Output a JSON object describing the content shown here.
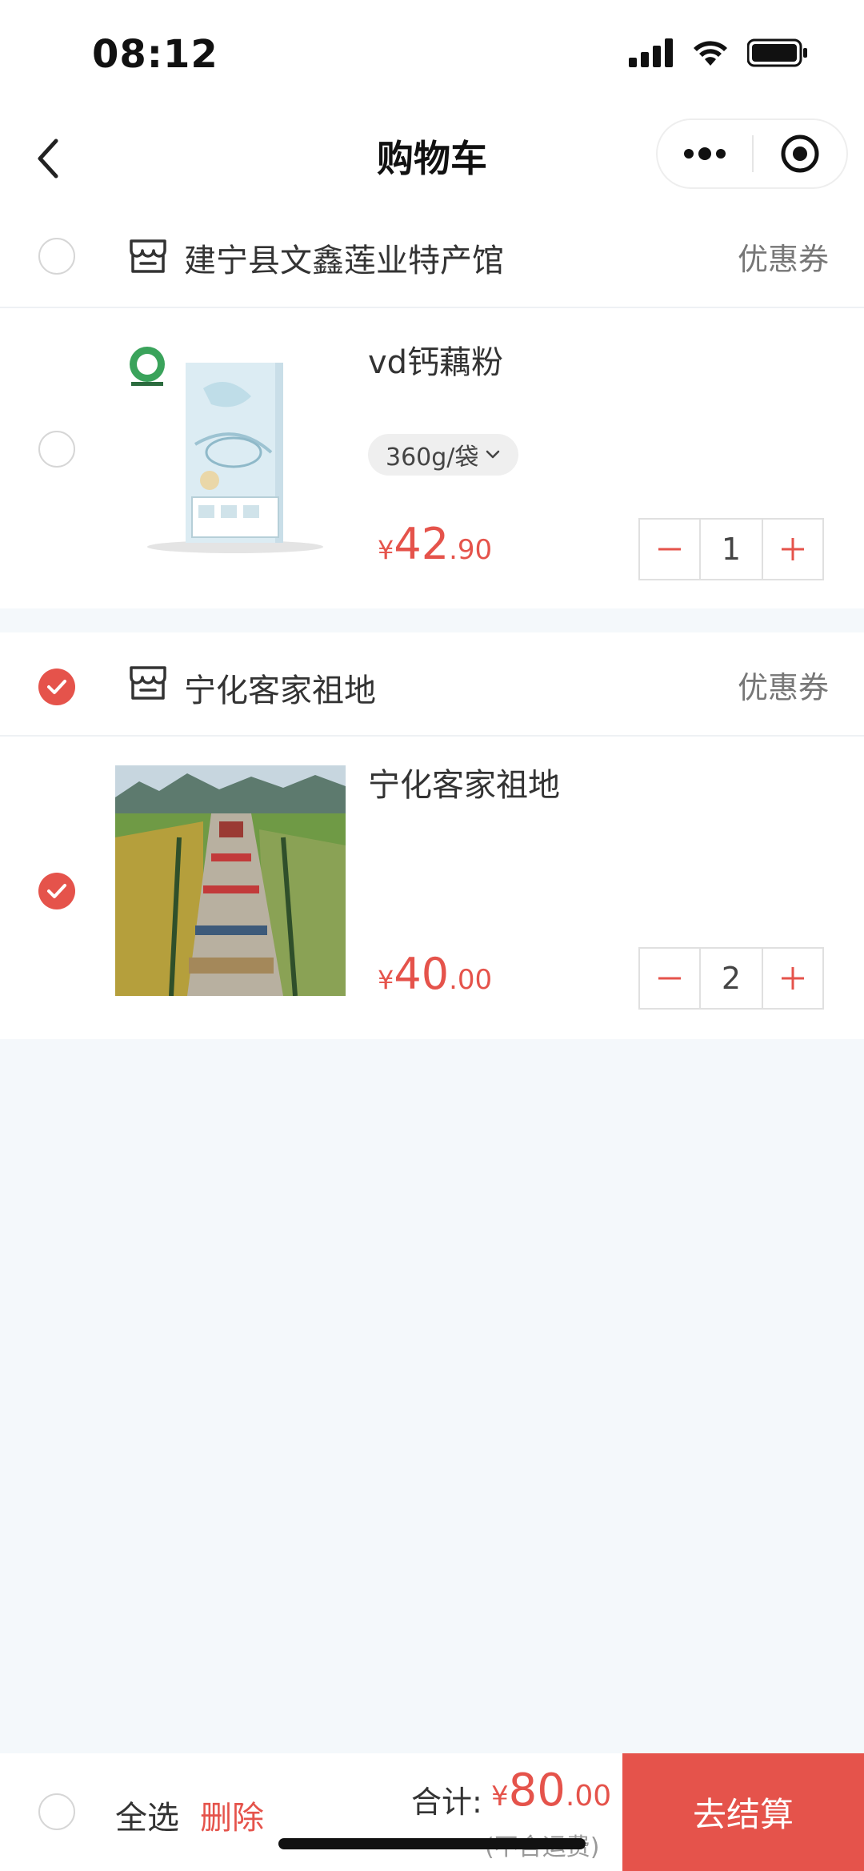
{
  "status_bar": {
    "time": "08:12"
  },
  "nav": {
    "title": "购物车"
  },
  "shops": [
    {
      "name": "建宁县文鑫莲业特产馆",
      "coupon": "优惠券",
      "checked": false,
      "item": {
        "title": "vd钙藕粉",
        "spec": "360g/袋",
        "price_symbol": "¥",
        "price_int": "42",
        "price_dec": ".90",
        "quantity": "1",
        "checked": false
      }
    },
    {
      "name": "宁化客家祖地",
      "coupon": "优惠券",
      "checked": true,
      "item": {
        "title": "宁化客家祖地",
        "price_symbol": "¥",
        "price_int": "40",
        "price_dec": ".00",
        "quantity": "2",
        "checked": true
      }
    }
  ],
  "bottom": {
    "select_all": "全选",
    "delete": "删除",
    "total_label": "合计:",
    "total_symbol": "¥",
    "total_int": "80",
    "total_dec": ".00",
    "shipping_note": "(不含运费)",
    "checkout": "去结算"
  },
  "colors": {
    "accent": "#e5534b",
    "background": "#f4f8fb"
  }
}
